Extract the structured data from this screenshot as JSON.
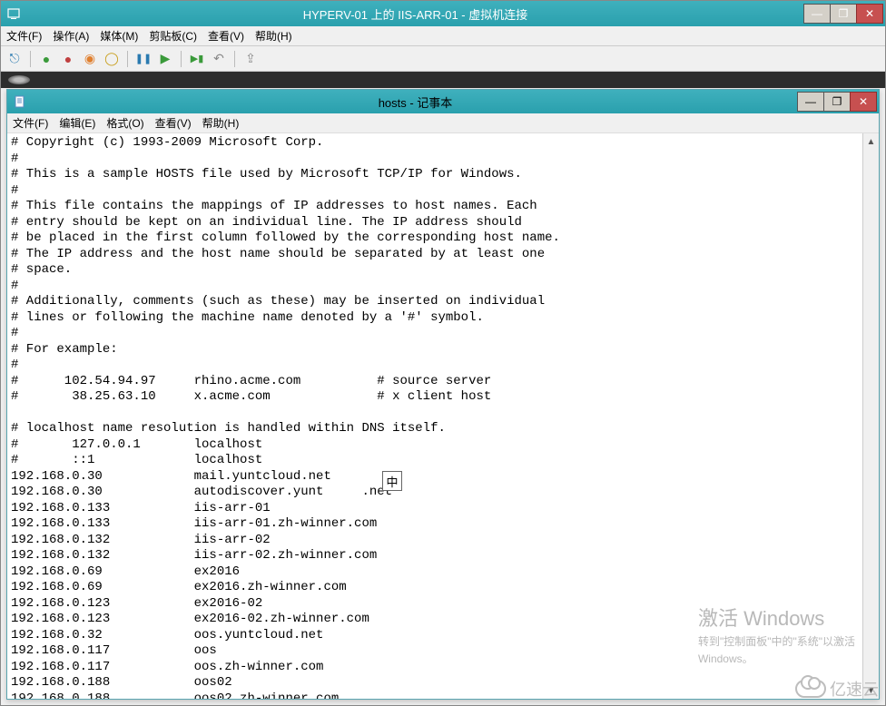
{
  "outer": {
    "title": "HYPERV-01 上的 IIS-ARR-01 - 虚拟机连接",
    "menu": [
      "文件(F)",
      "操作(A)",
      "媒体(M)",
      "剪贴板(C)",
      "查看(V)",
      "帮助(H)"
    ],
    "win_min": "—",
    "win_max": "❐",
    "win_close": "✕"
  },
  "toolbar_icons": {
    "ctrlaltdel": "⎋",
    "start": "●",
    "turnoff": "●",
    "shutdown": "◉",
    "save": "◯",
    "pause": "❚❚",
    "reset": "▶",
    "checkpoint": "▶▮",
    "revert": "↶",
    "share": "⇪"
  },
  "inner": {
    "title": "hosts - 记事本",
    "menu": [
      "文件(F)",
      "编辑(E)",
      "格式(O)",
      "查看(V)",
      "帮助(H)"
    ],
    "win_min": "—",
    "win_max": "❐",
    "win_close": "✕"
  },
  "editor_text": "# Copyright (c) 1993-2009 Microsoft Corp.\n#\n# This is a sample HOSTS file used by Microsoft TCP/IP for Windows.\n#\n# This file contains the mappings of IP addresses to host names. Each\n# entry should be kept on an individual line. The IP address should\n# be placed in the first column followed by the corresponding host name.\n# The IP address and the host name should be separated by at least one\n# space.\n#\n# Additionally, comments (such as these) may be inserted on individual\n# lines or following the machine name denoted by a '#' symbol.\n#\n# For example:\n#\n#      102.54.94.97     rhino.acme.com          # source server\n#       38.25.63.10     x.acme.com              # x client host\n\n# localhost name resolution is handled within DNS itself.\n#       127.0.0.1       localhost\n#       ::1             localhost\n192.168.0.30            mail.yuntcloud.net\n192.168.0.30            autodiscover.yunt     .net\n192.168.0.133           iis-arr-01\n192.168.0.133           iis-arr-01.zh-winner.com\n192.168.0.132           iis-arr-02\n192.168.0.132           iis-arr-02.zh-winner.com\n192.168.0.69            ex2016\n192.168.0.69            ex2016.zh-winner.com\n192.168.0.123           ex2016-02\n192.168.0.123           ex2016-02.zh-winner.com\n192.168.0.32            oos.yuntcloud.net\n192.168.0.117           oos\n192.168.0.117           oos.zh-winner.com\n192.168.0.188           oos02\n192.168.0.188           oos02.zh-winner.com",
  "ime": "中",
  "watermark": {
    "line1": "激活 Windows",
    "line2": "转到\"控制面板\"中的\"系统\"以激活",
    "line3": "Windows。"
  },
  "brand": "亿速云",
  "colors": {
    "titlebar": "#2aa0ad",
    "close": "#c75050"
  }
}
